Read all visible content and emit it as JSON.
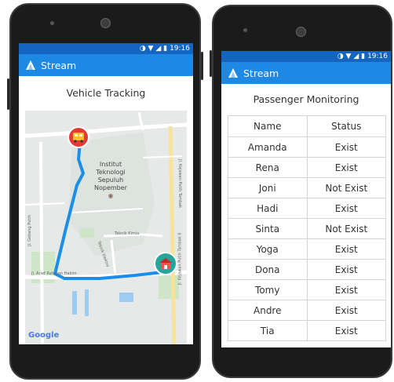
{
  "left_phone": {
    "status_time": "19:16",
    "app_title": "Stream",
    "page_title": "Vehicle Tracking",
    "map": {
      "place_label": [
        "Institut",
        "Teknologi",
        "Sepuluh",
        "Nopember"
      ],
      "street_labels": [
        "Jl. Arief Rahman Hakim",
        "Teknik Kimia",
        "Teknik Elektro",
        "Jl. Gebang Putih",
        "Jl. Kejawan Putih Tambak",
        "Jl. Kejawan Putih Tambak II"
      ],
      "attribution": "Google"
    }
  },
  "right_phone": {
    "status_time": "19:16",
    "app_title": "Stream",
    "page_title": "Passenger Monitoring",
    "table": {
      "headers": [
        "Name",
        "Status"
      ],
      "rows": [
        [
          "Amanda",
          "Exist"
        ],
        [
          "Rena",
          "Exist"
        ],
        [
          "Joni",
          "Not Exist"
        ],
        [
          "Hadi",
          "Exist"
        ],
        [
          "Sinta",
          "Not Exist"
        ],
        [
          "Yoga",
          "Exist"
        ],
        [
          "Dona",
          "Exist"
        ],
        [
          "Tomy",
          "Exist"
        ],
        [
          "Andre",
          "Exist"
        ],
        [
          "Tia",
          "Exist"
        ]
      ]
    }
  },
  "colors": {
    "statusbar": "#1565c0",
    "appbar": "#1e88e5",
    "route": "#1a8ee8",
    "bus_marker": "#e53935",
    "school_marker": "#26a69a"
  }
}
